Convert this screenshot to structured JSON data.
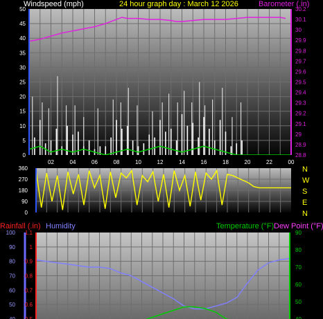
{
  "header": {
    "windspeed_label": "Windspeed (mph)",
    "title": "24 hour graph day : March 12 2026",
    "barometer_label": "Barometer (.in)"
  },
  "mid_labels": {
    "rainfall_label": "Rainfall (.in)",
    "humidity_label": "Humidity",
    "temperature_label": "Temperature (°F)",
    "dewpoint_label": "Dew Point (°F)"
  },
  "compass": [
    "N",
    "W",
    "S",
    "E",
    "N"
  ],
  "colors": {
    "windspeed": "#ffffff",
    "gust": "#d8d8d8",
    "avg_wind": "#00d000",
    "barometer": "#e020e0",
    "direction": "#ffff00",
    "rain": "#ff2020",
    "humidity": "#8080ff",
    "temperature": "#00cc00",
    "dewpoint": "#ff40ff",
    "title": "#ffff00"
  },
  "chart_data": [
    {
      "type": "line",
      "name": "wind-barometer",
      "x_ticks": [
        "02",
        "04",
        "06",
        "08",
        "10",
        "12",
        "14",
        "16",
        "18",
        "20",
        "22",
        "00"
      ],
      "y_left_ticks": [
        "0",
        "5",
        "10",
        "15",
        "20",
        "25",
        "30",
        "35",
        "40",
        "45",
        "50"
      ],
      "y_left_range": [
        0,
        50
      ],
      "y_right_ticks": [
        "28.8",
        "28.9",
        "29",
        "29.1",
        "29.2",
        "29.3",
        "29.4",
        "29.5",
        "29.6",
        "29.7",
        "29.8",
        "29.9",
        "30",
        "30.1",
        "30.2"
      ],
      "y_right_range": [
        28.8,
        30.2
      ],
      "x_range": [
        0,
        24
      ],
      "grid": true,
      "series": [
        {
          "name": "Barometer (.in)",
          "x": [
            0,
            1,
            2,
            3,
            4,
            5,
            6,
            7,
            8,
            8.5,
            9,
            10,
            11,
            12,
            13,
            13.5,
            14,
            15,
            16,
            17,
            18,
            19,
            20,
            21,
            22,
            23,
            23.5
          ],
          "y": [
            29.89,
            29.91,
            29.94,
            29.97,
            29.99,
            30.01,
            30.03,
            30.06,
            30.1,
            30.12,
            30.11,
            30.11,
            30.1,
            30.1,
            30.09,
            30.08,
            30.08,
            30.09,
            30.1,
            30.1,
            30.1,
            30.11,
            30.12,
            30.12,
            30.12,
            30.12,
            30.11
          ]
        },
        {
          "name": "Wind speed",
          "x": [
            0,
            0.5,
            1,
            1.5,
            2,
            2.5,
            3,
            3.5,
            4,
            4.5,
            5,
            5.5,
            6,
            6.5,
            7,
            7.5,
            8,
            8.5,
            9,
            9.5,
            10,
            10.5,
            11,
            11.5,
            12,
            12.5,
            13,
            13.5,
            14,
            14.5,
            15,
            15.5,
            16,
            16.5,
            17,
            17.5,
            18,
            18.5,
            19,
            19.5,
            20,
            20.5
          ],
          "y": [
            10,
            6,
            12,
            4,
            5,
            9,
            3,
            10,
            7,
            8,
            3,
            5,
            2,
            3,
            3,
            6,
            12,
            9,
            10,
            5,
            3,
            4,
            7,
            6,
            12,
            8,
            9,
            5,
            14,
            10,
            11,
            6,
            13,
            9,
            5,
            12,
            8,
            3,
            4,
            5,
            0,
            0
          ]
        },
        {
          "name": "Gust",
          "x": [
            0.3,
            1.2,
            1.8,
            2.6,
            3.4,
            4.2,
            5.0,
            6.3,
            7.7,
            8.4,
            9.1,
            9.9,
            11.3,
            12.2,
            12.8,
            13.6,
            14.2,
            14.9,
            15.6,
            16.1,
            16.8,
            17.7,
            18.6,
            19.4
          ],
          "y": [
            20,
            18,
            16,
            27,
            17,
            17,
            13,
            16,
            19,
            18,
            23,
            17,
            15,
            18,
            21,
            18,
            22,
            18,
            25,
            17,
            19,
            23,
            13,
            18
          ]
        },
        {
          "name": "Average wind",
          "x": [
            0,
            1,
            2,
            3,
            4,
            5,
            6,
            7,
            8,
            9,
            10,
            11,
            12,
            13,
            14,
            15,
            16,
            17,
            18,
            19,
            20,
            21,
            22,
            23,
            24
          ],
          "y": [
            2,
            3,
            1,
            2,
            1,
            2,
            1,
            0,
            1,
            2,
            1,
            2,
            3,
            2,
            1,
            2,
            3,
            2,
            1,
            0,
            0,
            0,
            0,
            0,
            0
          ]
        }
      ]
    },
    {
      "type": "line",
      "name": "wind-direction",
      "y_ticks": [
        "360",
        "270",
        "180",
        "90",
        "0"
      ],
      "y_range": [
        0,
        360
      ],
      "x_range": [
        0,
        24
      ],
      "grid": true,
      "series": [
        {
          "name": "Wind direction",
          "x": [
            0,
            0.5,
            1,
            1.5,
            2,
            2.5,
            3,
            3.5,
            4,
            4.5,
            5,
            5.5,
            6,
            6.5,
            7,
            7.5,
            8,
            8.5,
            9,
            9.5,
            10,
            10.5,
            11,
            11.5,
            12,
            12.5,
            13,
            13.5,
            14,
            14.5,
            15,
            15.5,
            16,
            16.5,
            17,
            17.5,
            18,
            18.5,
            19,
            19.5,
            20,
            20.5,
            21,
            22,
            23,
            24
          ],
          "y": [
            340,
            40,
            320,
            90,
            300,
            20,
            330,
            150,
            310,
            60,
            340,
            200,
            300,
            30,
            330,
            120,
            320,
            280,
            340,
            60,
            300,
            250,
            330,
            90,
            310,
            40,
            340,
            180,
            300,
            50,
            330,
            100,
            320,
            270,
            340,
            60,
            310,
            300,
            280,
            260,
            240,
            210,
            200,
            200,
            200,
            200
          ]
        }
      ]
    },
    {
      "type": "line",
      "name": "humidity-temperature",
      "y_left_ticks": [
        "40",
        "50",
        "60",
        "70",
        "80",
        "90",
        "100"
      ],
      "y_rain_ticks": [
        "0.5",
        "0.6",
        "0.7",
        "0.8",
        "0.9",
        "1",
        "1.1"
      ],
      "y_right_ticks": [
        "40",
        "50",
        "60",
        "70",
        "80",
        "90"
      ],
      "y_left_range": [
        40,
        100
      ],
      "y_right_range": [
        40,
        90
      ],
      "x_range": [
        0,
        24
      ],
      "grid": true,
      "series": [
        {
          "name": "Humidity",
          "x": [
            0,
            1,
            2,
            3,
            4,
            5,
            6,
            7,
            8,
            9,
            10,
            11,
            12,
            13,
            14,
            15,
            16,
            17,
            18,
            19,
            20,
            21,
            22,
            23,
            24
          ],
          "y": [
            81,
            80,
            79,
            78,
            77,
            76,
            76,
            75,
            72,
            70,
            66,
            62,
            58,
            54,
            49,
            47,
            47,
            49,
            51,
            55,
            65,
            74,
            79,
            81,
            82
          ]
        },
        {
          "name": "Temperature (°F)",
          "x": [
            0,
            1,
            2,
            3,
            4,
            5,
            6,
            7,
            8,
            9,
            10,
            11,
            12,
            13,
            14,
            15,
            16,
            17,
            18,
            19,
            20
          ],
          "y": [
            38,
            38,
            37,
            36,
            36,
            36,
            36,
            36,
            37,
            38,
            39,
            41,
            43,
            45,
            47,
            47,
            46,
            44,
            40,
            39,
            39
          ]
        }
      ]
    }
  ]
}
